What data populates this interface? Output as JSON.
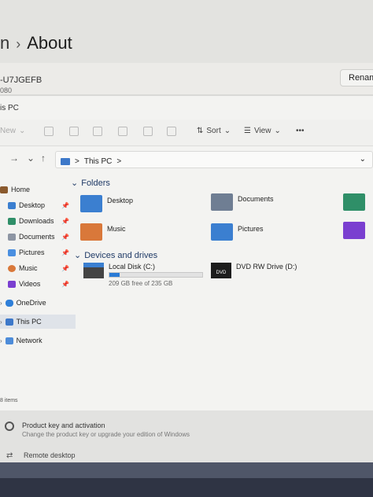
{
  "settings": {
    "breadcrumb_prev": "n",
    "page_title": "About",
    "device_name": "-U7JGEFB",
    "device_sub": "080",
    "rename_label": "Renam"
  },
  "explorer": {
    "window_title_fragment": "is PC",
    "toolbar": {
      "new_label": "New",
      "sort_label": "Sort",
      "view_label": "View",
      "more_label": "•••"
    },
    "address": {
      "root": "This PC",
      "sep": ">",
      "trail": ">"
    },
    "sidebar": [
      {
        "label": "Home",
        "icon": "home-icon",
        "pinned": false
      },
      {
        "label": "Desktop",
        "icon": "desktop-folder-icon",
        "pinned": true
      },
      {
        "label": "Downloads",
        "icon": "downloads-icon",
        "pinned": true
      },
      {
        "label": "Documents",
        "icon": "documents-icon",
        "pinned": true
      },
      {
        "label": "Pictures",
        "icon": "pictures-icon",
        "pinned": true
      },
      {
        "label": "Music",
        "icon": "music-icon",
        "pinned": true
      },
      {
        "label": "Videos",
        "icon": "videos-icon",
        "pinned": true
      },
      {
        "label": "OneDrive",
        "icon": "onedrive-icon",
        "pinned": false
      },
      {
        "label": "This PC",
        "icon": "this-pc-icon",
        "pinned": false
      },
      {
        "label": "Network",
        "icon": "network-icon",
        "pinned": false
      }
    ],
    "folders_header": "Folders",
    "folders": [
      {
        "label": "Desktop",
        "icon": "desktop-folder-icon"
      },
      {
        "label": "Documents",
        "icon": "documents-folder-icon"
      },
      {
        "label": "Music",
        "icon": "music-folder-icon"
      },
      {
        "label": "Pictures",
        "icon": "pictures-folder-icon"
      }
    ],
    "drives_header": "Devices and drives",
    "drives": [
      {
        "label": "Local Disk (C:)",
        "free": "209 GB free of 235 GB",
        "used_fraction": 0.11
      },
      {
        "label": "DVD RW Drive (D:)",
        "badge": "DVD"
      }
    ],
    "status_text": "8 items"
  },
  "lower": {
    "product_key_title": "Product key and activation",
    "product_key_sub": "Change the product key or upgrade your edition of Windows",
    "remote_desktop": "Remote desktop"
  },
  "colors": {
    "accent": "#2a7bd6",
    "folder_blue": "#3b7fd0",
    "music_orange": "#d9783a",
    "video_purple": "#7a3fd0",
    "download_green": "#2f8f68"
  }
}
